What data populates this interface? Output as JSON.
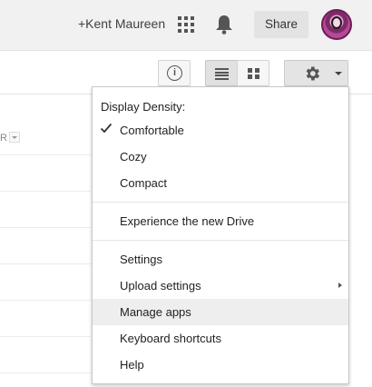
{
  "header": {
    "user_link": "+Kent Maureen",
    "share_label": "Share",
    "icons": {
      "apps": "apps-grid-icon",
      "notifications": "bell-icon",
      "avatar": "user-avatar"
    }
  },
  "toolbar": {
    "info_icon": "info-icon",
    "info_glyph": "i",
    "list_view_icon": "list-view-icon",
    "grid_view_icon": "grid-view-icon",
    "settings_icon": "gear-icon",
    "dropdown_icon": "caret-down-icon"
  },
  "background": {
    "column_header_fragment": "R"
  },
  "settings_menu": {
    "heading": "Display Density:",
    "density_options": [
      {
        "label": "Comfortable",
        "checked": true
      },
      {
        "label": "Cozy",
        "checked": false
      },
      {
        "label": "Compact",
        "checked": false
      }
    ],
    "experience_item": "Experience the new Drive",
    "items": [
      {
        "label": "Settings",
        "has_submenu": false,
        "highlighted": false
      },
      {
        "label": "Upload settings",
        "has_submenu": true,
        "highlighted": false
      },
      {
        "label": "Manage apps",
        "has_submenu": false,
        "highlighted": true
      },
      {
        "label": "Keyboard shortcuts",
        "has_submenu": false,
        "highlighted": false
      },
      {
        "label": "Help",
        "has_submenu": false,
        "highlighted": false
      }
    ]
  },
  "colors": {
    "topbar_bg": "#f1f1f1",
    "highlight": "#eeeeee",
    "accent_icon": "#555555"
  }
}
